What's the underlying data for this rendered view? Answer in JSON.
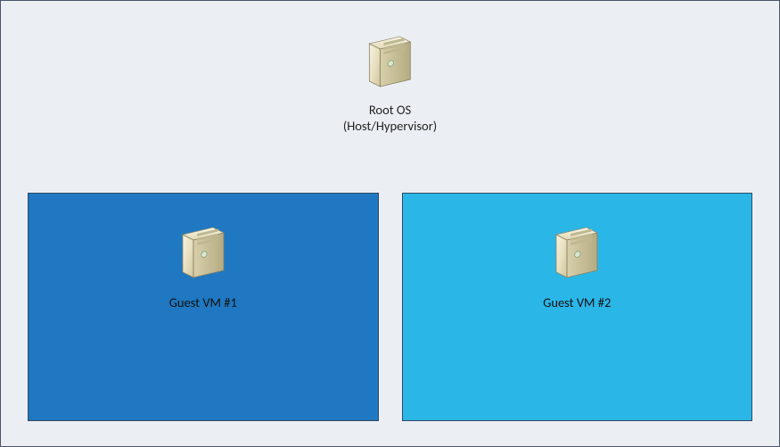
{
  "root": {
    "label_line1": "Root OS",
    "label_line2": "(Host/Hypervisor)"
  },
  "vms": [
    {
      "label": "Guest VM #1",
      "bg": "#1f78c1"
    },
    {
      "label": "Guest VM #2",
      "bg": "#2bb6e8"
    }
  ],
  "icon_name": "server-tower-icon"
}
